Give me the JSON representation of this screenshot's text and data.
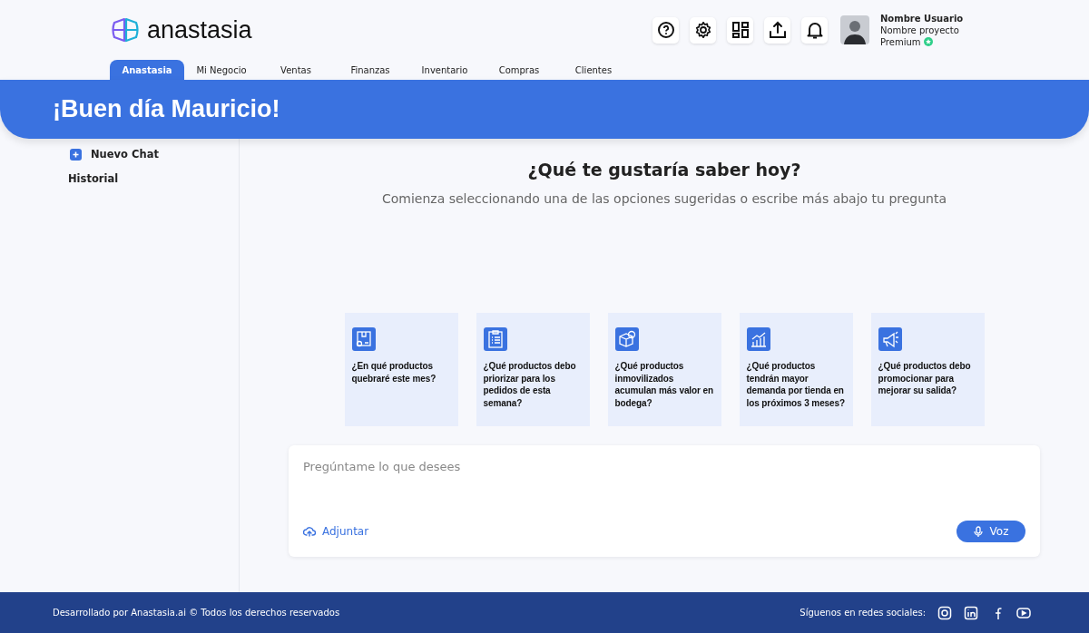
{
  "brand": {
    "name": "anastasia"
  },
  "user": {
    "name": "Nombre Usuario",
    "project": "Nombre proyecto",
    "plan": "Premium"
  },
  "tabs": [
    {
      "label": "Anastasia",
      "selected": true
    },
    {
      "label": "Mi Negocio",
      "selected": false
    },
    {
      "label": "Ventas",
      "selected": false
    },
    {
      "label": "Finanzas",
      "selected": false
    },
    {
      "label": "Inventario",
      "selected": false
    },
    {
      "label": "Compras",
      "selected": false
    },
    {
      "label": "Clientes",
      "selected": false
    }
  ],
  "banner": {
    "greeting": "¡Buen día Mauricio!"
  },
  "sidebar": {
    "new_chat": "Nuevo Chat",
    "history": "Historial"
  },
  "main": {
    "title": "¿Qué te gustaría saber hoy?",
    "subtitle": "Comienza seleccionando una de las opciones sugeridas o escribe más abajo tu pregunta"
  },
  "suggestions": [
    {
      "text": "¿En qué productos quebraré este mes?"
    },
    {
      "text": "¿Qué productos debo priorizar para los pedidos de esta semana?"
    },
    {
      "text": "¿Qué productos inmovilizados acumulan más valor en bodega?"
    },
    {
      "text": "¿Qué productos tendrán mayor demanda por tienda en los próximos 3 meses?"
    },
    {
      "text": "¿Qué productos debo promocionar para mejorar su salida?"
    }
  ],
  "composer": {
    "placeholder": "Pregúntame lo que desees",
    "attach": "Adjuntar",
    "voice": "Voz"
  },
  "footer": {
    "copyright": "Desarrollado por Anastasia.ai © Todos los derechos reservados",
    "social_label": "Síguenos en redes sociales:"
  }
}
